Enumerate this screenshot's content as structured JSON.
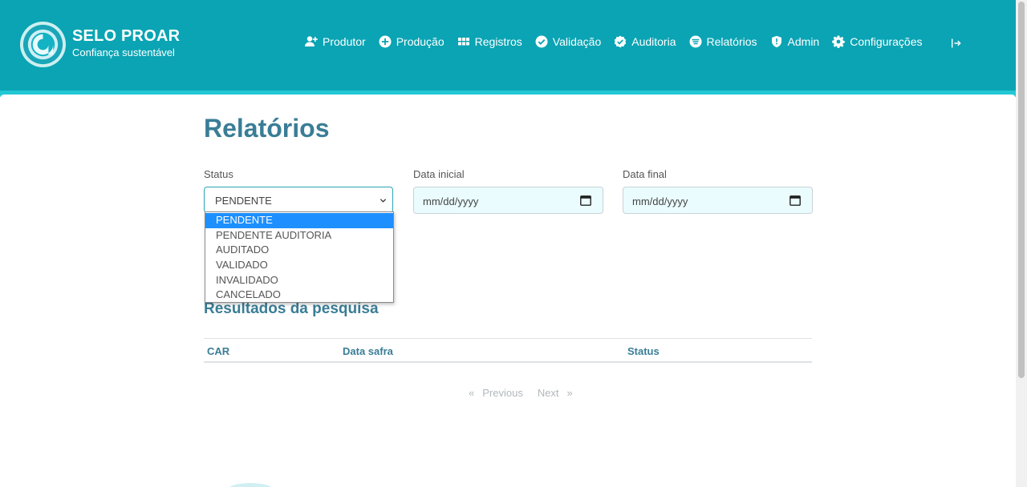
{
  "brand": {
    "title": "SELO PROAR",
    "subtitle": "Confiança sustentável",
    "colors": {
      "navbar": "#0aa4b4",
      "accent": "#3a7d96",
      "selected": "#1e8fff"
    }
  },
  "nav": {
    "items": [
      {
        "label": "Produtor",
        "icon": "user-plus-icon"
      },
      {
        "label": "Produção",
        "icon": "plus-circle-icon"
      },
      {
        "label": "Registros",
        "icon": "grid-icon"
      },
      {
        "label": "Validação",
        "icon": "check-circle-icon"
      },
      {
        "label": "Auditoria",
        "icon": "badge-check-icon"
      },
      {
        "label": "Relatórios",
        "icon": "list-circle-icon"
      },
      {
        "label": "Admin",
        "icon": "shield-icon"
      },
      {
        "label": "Configurações",
        "icon": "gear-icon"
      }
    ],
    "logout_icon": "logout-icon"
  },
  "page": {
    "title": "Relatórios"
  },
  "filters": {
    "status_label": "Status",
    "status_value": "PENDENTE",
    "status_options": [
      "PENDENTE",
      "PENDENTE AUDITORIA",
      "AUDITADO",
      "VALIDADO",
      "INVALIDADO",
      "CANCELADO"
    ],
    "start_label": "Data inicial",
    "start_value": "mm/dd/yyyy",
    "end_label": "Data final",
    "end_value": "mm/dd/yyyy"
  },
  "results": {
    "title": "Resultados da pesquisa",
    "columns": [
      "CAR",
      "Data safra",
      "Status"
    ]
  },
  "pagination": {
    "prev": "«",
    "prev_label": "Previous",
    "next_label": "Next",
    "next": "»"
  }
}
